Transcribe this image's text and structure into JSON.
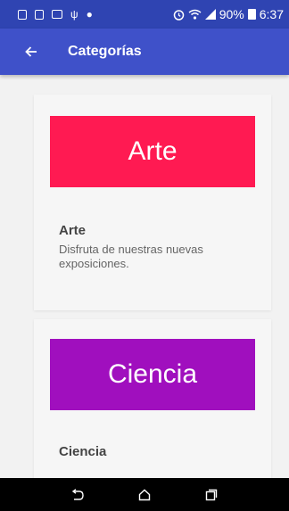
{
  "status_bar": {
    "percent": "90%",
    "time": "6:37"
  },
  "app_bar": {
    "title": "Categorías"
  },
  "categories": [
    {
      "banner_label": "Arte",
      "banner_color": "#ff1a52",
      "title": "Arte",
      "description": "Disfruta de nuestras nuevas exposiciones."
    },
    {
      "banner_label": "Ciencia",
      "banner_color": "#a00fbe",
      "title": "Ciencia",
      "description": ""
    }
  ],
  "colors": {
    "status_bar": "#2f44b2",
    "app_bar": "#3f51c9",
    "background": "#f2f2f2",
    "nav_bar": "#000000"
  },
  "icons": {
    "status_left": [
      "notification-icon",
      "notification-icon",
      "gallery-icon",
      "usb-icon",
      "android-icon"
    ],
    "status_right": [
      "alarm-icon",
      "wifi-icon",
      "signal-icon",
      "battery-icon"
    ],
    "app_bar": "back-arrow-icon",
    "nav": [
      "back-icon",
      "home-icon",
      "recents-icon"
    ]
  }
}
